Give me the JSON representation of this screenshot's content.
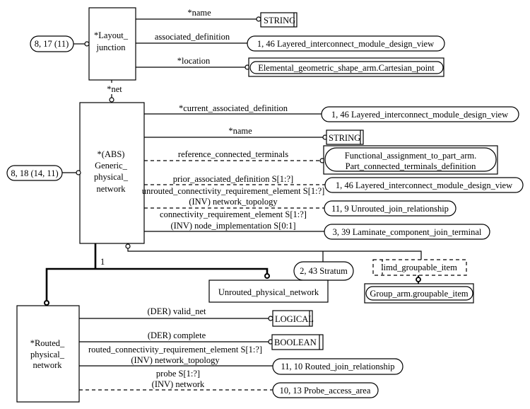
{
  "entities": {
    "layout_junction": [
      "*Layout_",
      "junction"
    ],
    "generic_physical_network": [
      "*(ABS)",
      "Generic_",
      "physical_",
      "network"
    ],
    "routed_physical_network": [
      "*Routed_",
      "physical_",
      "network"
    ],
    "unrouted_physical_network": "Unrouted_physical_network"
  },
  "page_refs": {
    "layout_junction": "8, 17 (11)",
    "generic_physical_network": "8, 18 (14, 11)"
  },
  "attributes": {
    "lj_name": "*name",
    "lj_associated_definition": "associated_definition",
    "lj_location": "*location",
    "lj_net": "*net",
    "gpn_current_associated_definition": "*current_associated_definition",
    "gpn_name": "*name",
    "gpn_reference_connected_terminals": "reference_connected_terminals",
    "gpn_prior_associated_definition": "prior_associated_definition S[1:?]",
    "gpn_unrouted": [
      "unrouted_connectivity_requirement_element S[1:?]",
      "(INV) network_topology"
    ],
    "gpn_connectivity": [
      "connectivity_requirement_element S[1:?]",
      "(INV) node_implementation S[0:1]"
    ],
    "supertype_cardinality": "1",
    "rpn_valid_net": "(DER) valid_net",
    "rpn_complete": "(DER) complete",
    "rpn_routed": [
      "routed_connectivity_requirement_element S[1:?]",
      "(INV) network_topology"
    ],
    "rpn_probe": [
      "probe S[1:?]",
      "(INV) network"
    ]
  },
  "targets": {
    "string": "STRING",
    "layered_view": "1, 46 Layered_interconnect_module_design_view",
    "cartesian_point": "Elemental_geometric_shape_arm.Cartesian_point",
    "part_connected_terminals": [
      "Functional_assignment_to_part_arm.",
      "Part_connected_terminals_definition"
    ],
    "unrouted_join": "11, 9 Unrouted_join_relationship",
    "laminate_join_terminal": "3, 39 Laminate_component_join_terminal",
    "stratum": "2, 43 Stratum",
    "limd_groupable_item": "limd_groupable_item",
    "group_groupable_item": "Group_arm.groupable_item",
    "logical": "LOGICAL",
    "boolean": "BOOLEAN",
    "routed_join": "11, 10 Routed_join_relationship",
    "probe_access_area": "10, 13 Probe_access_area"
  }
}
